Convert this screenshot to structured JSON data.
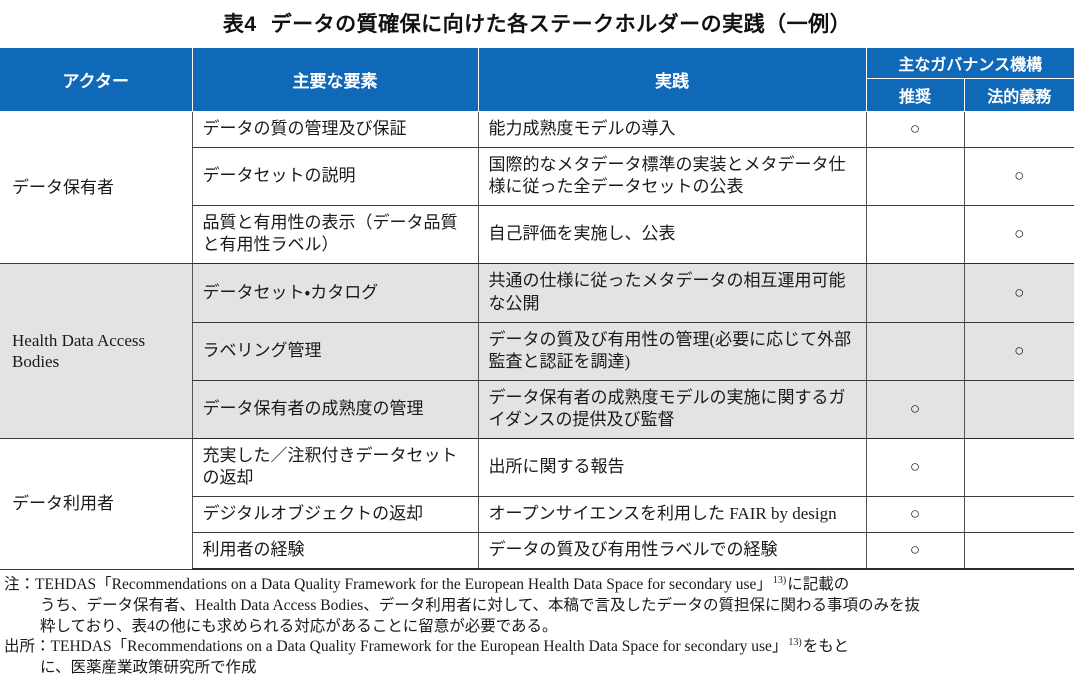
{
  "title": {
    "number": "表4",
    "text": "データの質確保に向けた各ステークホルダーの実践（一例）"
  },
  "colors": {
    "header_blue": "#1068b8",
    "shaded_row": "#e3e3e3",
    "rule": "#3a3a3a"
  },
  "table": {
    "headers": {
      "actor": "アクター",
      "element": "主要な要素",
      "practice": "実践",
      "governance": "主なガバナンス機構",
      "recommended": "推奨",
      "legal": "法的義務"
    },
    "mark": "○",
    "groups": [
      {
        "actor": "データ保有者",
        "shaded": false,
        "rows": [
          {
            "element": "データの質の管理及び保証",
            "practice": "能力成熟度モデルの導入",
            "recommended": "○",
            "legal": ""
          },
          {
            "element": "データセットの説明",
            "practice": "国際的なメタデータ標準の実装とメタデータ仕様に従った全データセットの公表",
            "recommended": "",
            "legal": "○"
          },
          {
            "element": "品質と有用性の表示（データ品質と有用性ラベル）",
            "practice": "自己評価を実施し、公表",
            "recommended": "",
            "legal": "○"
          }
        ]
      },
      {
        "actor": "Health Data Access Bodies",
        "shaded": true,
        "rows": [
          {
            "element": "データセット・カタログ",
            "practice": "共通の仕様に従ったメタデータの相互運用可能な公開",
            "recommended": "",
            "legal": "○"
          },
          {
            "element": "ラベリング管理",
            "practice": "データの質及び有用性の管理(必要に応じて外部監査と認証を調達)",
            "recommended": "",
            "legal": "○"
          },
          {
            "element": "データ保有者の成熟度の管理",
            "practice": "データ保有者の成熟度モデルの実施に関するガイダンスの提供及び監督",
            "recommended": "○",
            "legal": ""
          }
        ]
      },
      {
        "actor": "データ利用者",
        "shaded": false,
        "rows": [
          {
            "element": "充実した／注釈付きデータセットの返却",
            "practice": "出所に関する報告",
            "recommended": "○",
            "legal": ""
          },
          {
            "element": "デジタルオブジェクトの返却",
            "practice": "オープンサイエンスを利用した FAIR by design",
            "recommended": "○",
            "legal": ""
          },
          {
            "element": "利用者の経験",
            "practice": "データの質及び有用性ラベルでの経験",
            "recommended": "○",
            "legal": ""
          }
        ]
      }
    ]
  },
  "notes": {
    "note_label": "注：",
    "note_line1_a": "TEHDAS「Recommendations on a Data Quality Framework for the European Health Data Space for secondary use」",
    "note_ref1": "13)",
    "note_line1_b": "に記載の",
    "note_line2": "うち、データ保有者、Health Data Access Bodies、データ利用者に対して、本稿で言及したデータの質担保に関わる事項のみを抜",
    "note_line3": "粋しており、表4の他にも求められる対応があることに留意が必要である。",
    "source_label": "出所：",
    "source_line1_a": "TEHDAS「Recommendations on a Data Quality Framework for the European Health Data Space for secondary use」",
    "source_ref1": "13)",
    "source_line1_b": "をもと",
    "source_line2": "に、医薬産業政策研究所で作成"
  }
}
